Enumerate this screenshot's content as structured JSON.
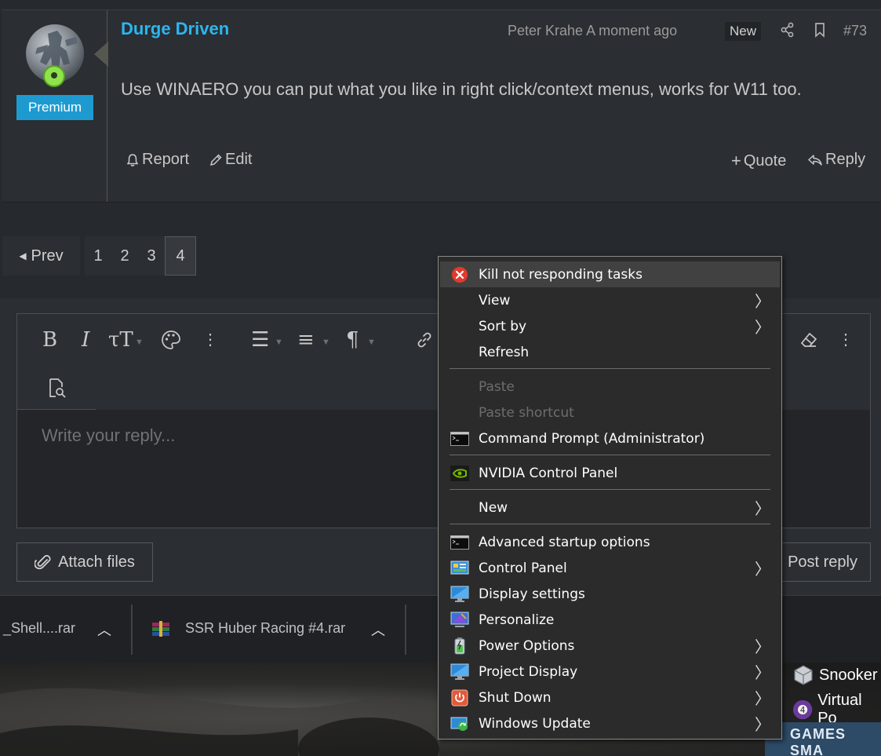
{
  "post": {
    "username": "Durge Driven",
    "badge": "Premium",
    "author_time": "Peter Krahe A moment ago",
    "new_label": "New",
    "post_number": "#73",
    "body": "Use WINAERO you can put what you like in right click/context menus, works for W11 too.",
    "actions": {
      "report": "Report",
      "edit": "Edit",
      "quote": "Quote",
      "reply": "Reply"
    }
  },
  "pagination": {
    "prev": "Prev",
    "pages": [
      "1",
      "2",
      "3",
      "4"
    ],
    "current": "4"
  },
  "editor": {
    "placeholder": "Write your reply...",
    "attach": "Attach files",
    "post_reply": "Post reply"
  },
  "downloads": [
    {
      "name": "_Shell....rar"
    },
    {
      "name": "SSR Huber Racing #4.rar"
    }
  ],
  "desktop": {
    "icons": [
      "Snooker",
      "Virtual Po"
    ],
    "games_label": "GAMES SMA"
  },
  "context_menu": {
    "items": [
      {
        "label": "Kill not responding tasks",
        "icon": "red-x-icon"
      },
      {
        "label": "View",
        "submenu": true
      },
      {
        "label": "Sort by",
        "submenu": true
      },
      {
        "label": "Refresh"
      },
      {
        "label": "Paste",
        "disabled": true
      },
      {
        "label": "Paste shortcut",
        "disabled": true
      },
      {
        "label": "Command Prompt (Administrator)",
        "icon": "cmd-icon"
      },
      {
        "label": "NVIDIA Control Panel",
        "icon": "nvidia-icon"
      },
      {
        "label": "New",
        "submenu": true
      },
      {
        "label": "Advanced startup options",
        "icon": "cmd-icon"
      },
      {
        "label": "Control Panel",
        "icon": "control-panel-icon",
        "submenu": true
      },
      {
        "label": "Display settings",
        "icon": "monitor-icon"
      },
      {
        "label": "Personalize",
        "icon": "personalize-icon"
      },
      {
        "label": "Power Options",
        "icon": "battery-icon",
        "submenu": true
      },
      {
        "label": "Project Display",
        "icon": "monitor-icon",
        "submenu": true
      },
      {
        "label": "Shut Down",
        "icon": "power-icon",
        "submenu": true
      },
      {
        "label": "Windows Update",
        "icon": "update-icon",
        "submenu": true
      }
    ]
  },
  "colors": {
    "username": "#2cb6f0",
    "premium_badge": "#1d9bd1",
    "menu_bg": "#2b2b2b"
  }
}
